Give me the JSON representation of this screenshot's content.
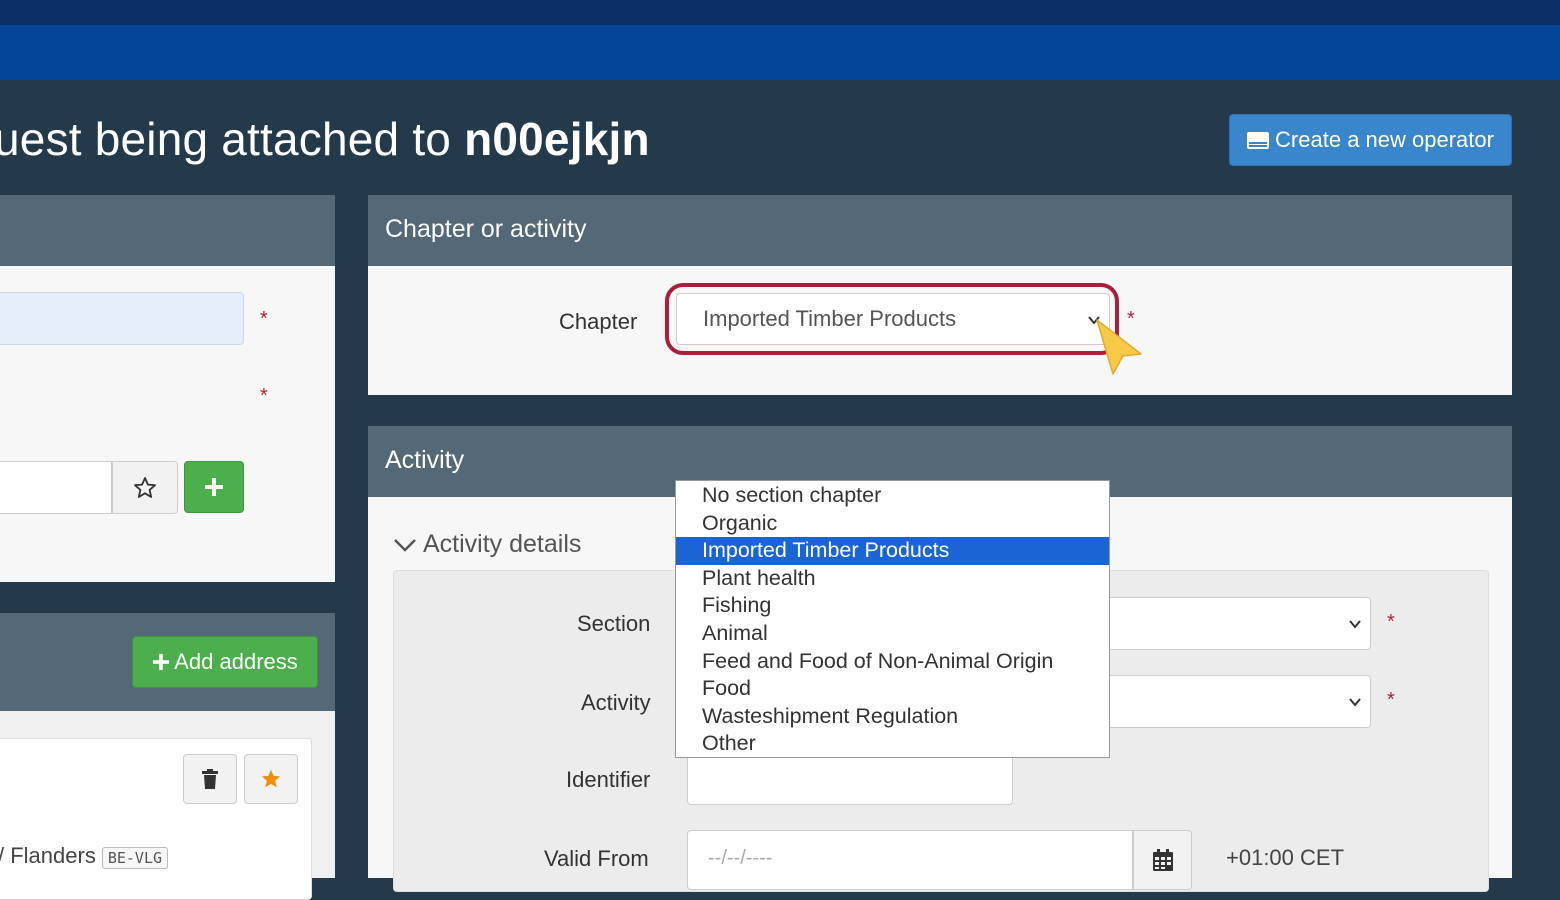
{
  "header": {
    "title_prefix": "uest being attached to",
    "title_user": "n00ejkjn",
    "create_button": "Create a new operator",
    "create_icon": "id-card-icon"
  },
  "left_panel": {
    "required_marker": "*",
    "add_address_button": "Add address",
    "address_region": "/ Flanders",
    "address_code": "BE-VLG"
  },
  "chapter_panel": {
    "title": "Chapter or activity",
    "chapter_label": "Chapter",
    "chapter_value": "Imported Timber Products",
    "required_marker": "*"
  },
  "activity_panel": {
    "title": "Activity",
    "details_toggle": "Activity details",
    "section_label": "Section",
    "activity_label": "Activity",
    "identifier_label": "Identifier",
    "valid_from_label": "Valid From",
    "valid_from_placeholder": "--/--/----",
    "timezone": "+01:00 CET",
    "required_marker": "*"
  },
  "chapter_dropdown": {
    "options": [
      "No section chapter",
      "Organic",
      "Imported Timber Products",
      "Plant health",
      "Fishing",
      "Animal",
      "Feed and Food of Non-Animal Origin",
      "Food",
      "Wasteshipment Regulation",
      "Other"
    ],
    "selected_index": 2
  },
  "colors": {
    "topbar_dark": "#0a2f67",
    "topbar_blue": "#044597",
    "panel_header": "#546877",
    "primary_button": "#3a86cc",
    "success_button": "#4cae4c",
    "required": "#b0213a",
    "selection": "#1a64d6",
    "highlight_ring": "#a8203d",
    "cursor": "#f7c948"
  }
}
